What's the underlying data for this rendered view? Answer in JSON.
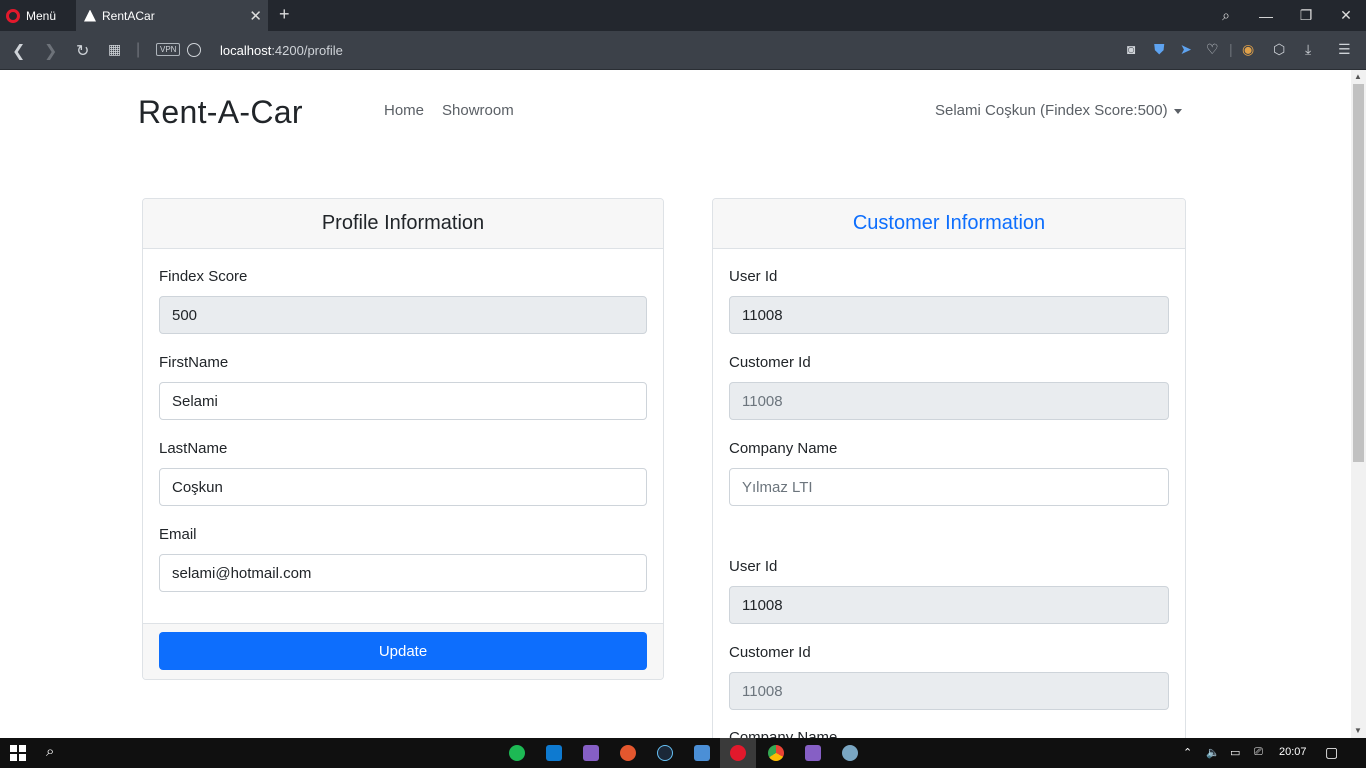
{
  "browser": {
    "menu_label": "Menü",
    "tab_title": "RentACar",
    "url_host": "localhost",
    "url_path": ":4200/profile",
    "vpn_label": "VPN"
  },
  "navbar": {
    "brand": "Rent-A-Car",
    "links": [
      "Home",
      "Showroom"
    ],
    "user_menu": "Selami Coşkun (Findex Score:500)"
  },
  "profile_card": {
    "title": "Profile Information",
    "fields": [
      {
        "label": "Findex Score",
        "value": "500"
      },
      {
        "label": "FirstName",
        "value": "Selami"
      },
      {
        "label": "LastName",
        "value": "Coşkun"
      },
      {
        "label": "Email",
        "value": "selami@hotmail.com"
      }
    ],
    "update_label": "Update"
  },
  "customer_card": {
    "title": "Customer Information",
    "groups": [
      {
        "user_id_label": "User Id",
        "user_id": "11008",
        "customer_id_label": "Customer Id",
        "customer_id": "11008",
        "company_label": "Company Name",
        "company_value": "Yılmaz LTI"
      },
      {
        "user_id_label": "User Id",
        "user_id": "11008",
        "customer_id_label": "Customer Id",
        "customer_id": "11008",
        "company_label": "Company Name"
      }
    ]
  },
  "taskbar": {
    "time": "20:07"
  },
  "colors": {
    "primary": "#0d6efd",
    "readonly_bg": "#e9ecef",
    "card_header_bg": "#f7f7f7"
  }
}
